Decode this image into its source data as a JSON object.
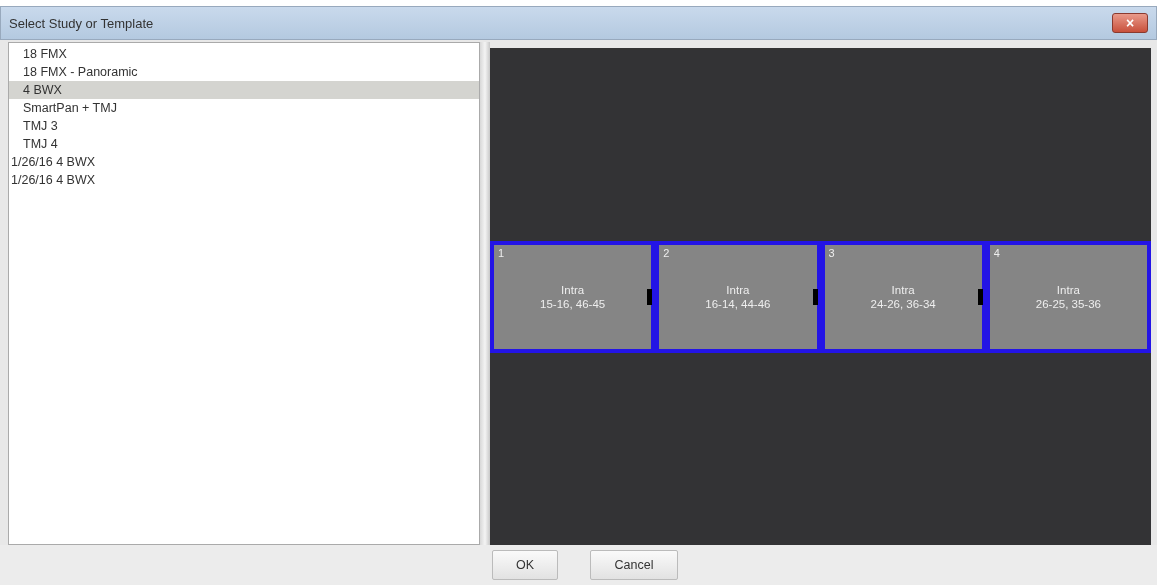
{
  "window": {
    "title": "Select Study or Template",
    "close_label": "×"
  },
  "list": {
    "items": [
      {
        "label": "18 FMX",
        "kind": "template",
        "selected": false
      },
      {
        "label": "18 FMX - Panoramic",
        "kind": "template",
        "selected": false
      },
      {
        "label": "4 BWX",
        "kind": "template",
        "selected": true
      },
      {
        "label": "SmartPan + TMJ",
        "kind": "template",
        "selected": false
      },
      {
        "label": "TMJ 3",
        "kind": "template",
        "selected": false
      },
      {
        "label": "TMJ 4",
        "kind": "template",
        "selected": false
      },
      {
        "label": "1/26/16  4 BWX",
        "kind": "study",
        "selected": false
      },
      {
        "label": "1/26/16  4 BWX",
        "kind": "study",
        "selected": false
      }
    ]
  },
  "preview": {
    "slots": [
      {
        "number": "1",
        "type": "Intra",
        "teeth": "15-16, 46-45"
      },
      {
        "number": "2",
        "type": "Intra",
        "teeth": "16-14, 44-46"
      },
      {
        "number": "3",
        "type": "Intra",
        "teeth": "24-26, 36-34"
      },
      {
        "number": "4",
        "type": "Intra",
        "teeth": "26-25, 35-36"
      }
    ]
  },
  "buttons": [
    "OK",
    "Cancel"
  ]
}
